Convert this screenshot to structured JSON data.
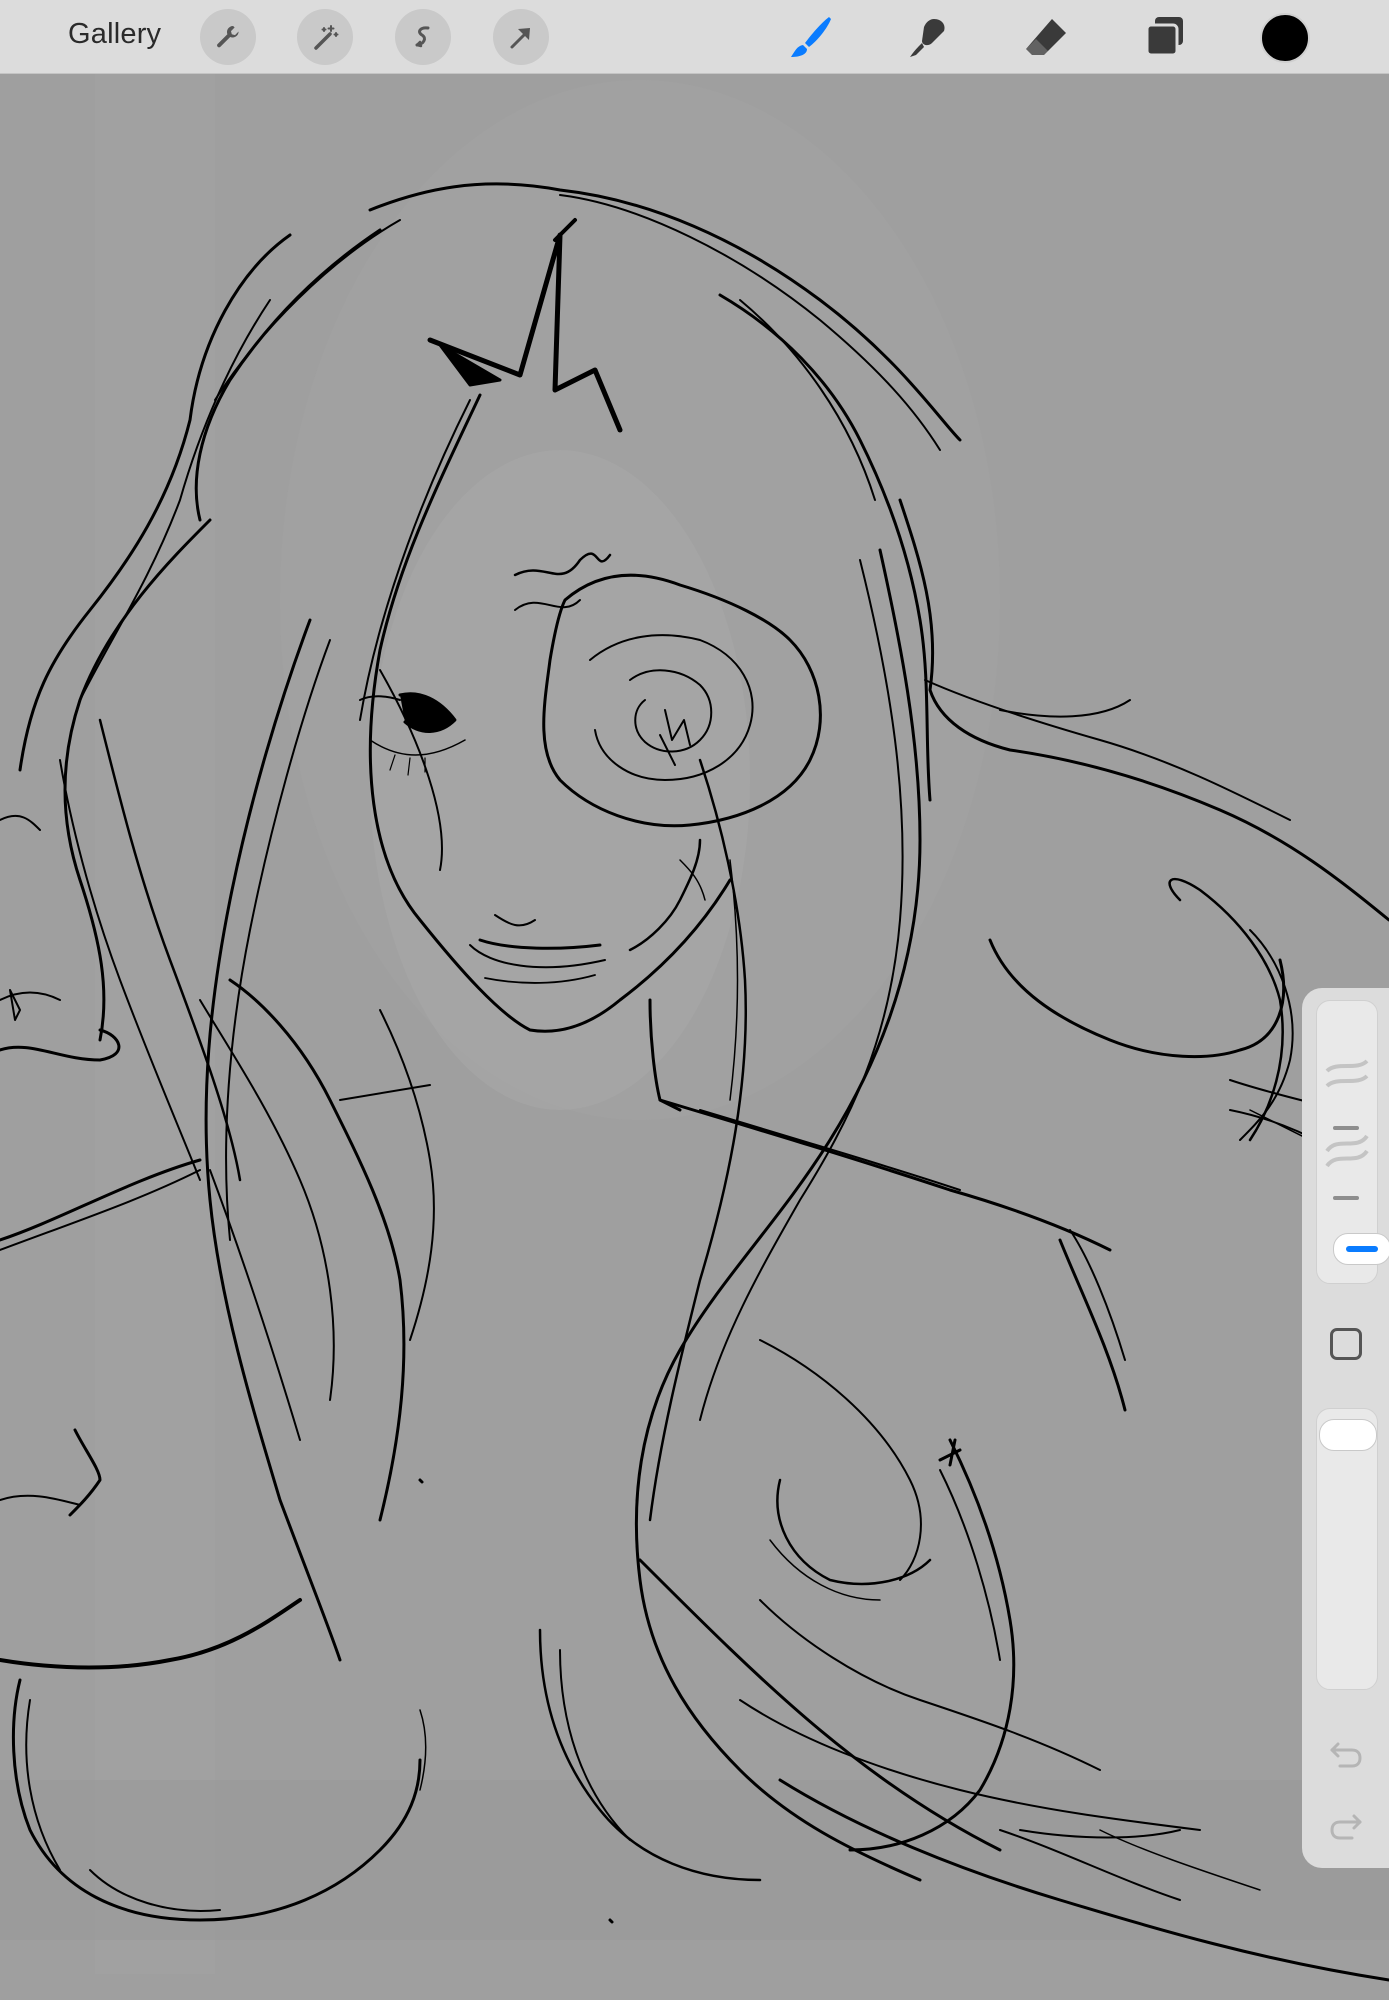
{
  "toolbar": {
    "gallery_label": "Gallery",
    "left_tools": [
      "wrench-icon",
      "magic-wand-icon",
      "selection-icon",
      "transform-arrow-icon"
    ],
    "right_tools": [
      "brush-icon",
      "smudge-icon",
      "eraser-icon",
      "layers-icon"
    ],
    "active_tool": "brush-icon",
    "active_color": "#0a7cff",
    "current_color": "#000000"
  },
  "sidebar": {
    "controls": [
      "brush-size-slider",
      "modify-button",
      "opacity-slider",
      "undo-button",
      "redo-button"
    ]
  },
  "canvas": {
    "background": "#9f9f9f"
  }
}
